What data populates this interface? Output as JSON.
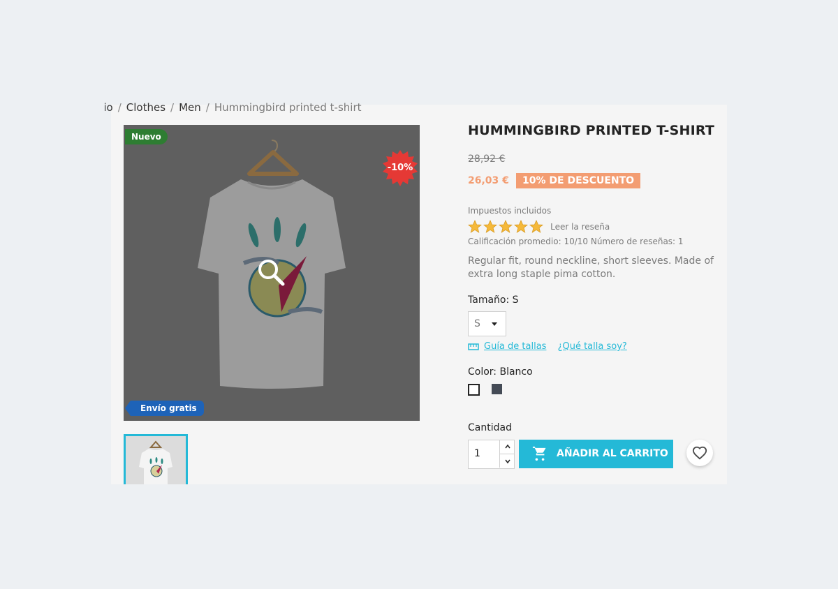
{
  "breadcrumb": {
    "items": [
      "Inicio",
      "Clothes",
      "Men",
      "Hummingbird printed t-shirt"
    ],
    "separator": "/"
  },
  "product": {
    "title": "HUMMINGBIRD PRINTED T-SHIRT",
    "old_price": "28,92 €",
    "price": "26,03 €",
    "discount_label": "10% DE DESCUENTO",
    "tax_label": "Impuestos incluidos",
    "rating_stars": 5,
    "read_review": "Leer la reseña",
    "rating_summary": "Calificación promedio: 10/10 Número de reseñas: 1",
    "description": "Regular fit, round neckline, short sleeves. Made of extra long staple pima cotton."
  },
  "badges": {
    "new": "Nuevo",
    "discount": "-10%",
    "shipping": "Envío gratis"
  },
  "size": {
    "label": "Tamaño: S",
    "selected": "S",
    "guide_link": "Guía de tallas",
    "which_size_link": "¿Qué talla soy?"
  },
  "color": {
    "label": "Color: Blanco",
    "swatches": [
      "#ffffff",
      "#444b56"
    ]
  },
  "quantity": {
    "label": "Cantidad",
    "value": "1"
  },
  "cart": {
    "add_label": "AÑADIR AL CARRITO"
  },
  "colors": {
    "accent": "#24b9d7",
    "discount": "#f39d72",
    "new_badge": "#2e7d32",
    "shipping_badge": "#1e63b8",
    "discount_badge": "#e53935"
  },
  "icons": [
    "zoom-icon",
    "ruler-icon",
    "cart-icon",
    "heart-icon",
    "chevron-up-icon",
    "chevron-down-icon",
    "star-icon"
  ]
}
